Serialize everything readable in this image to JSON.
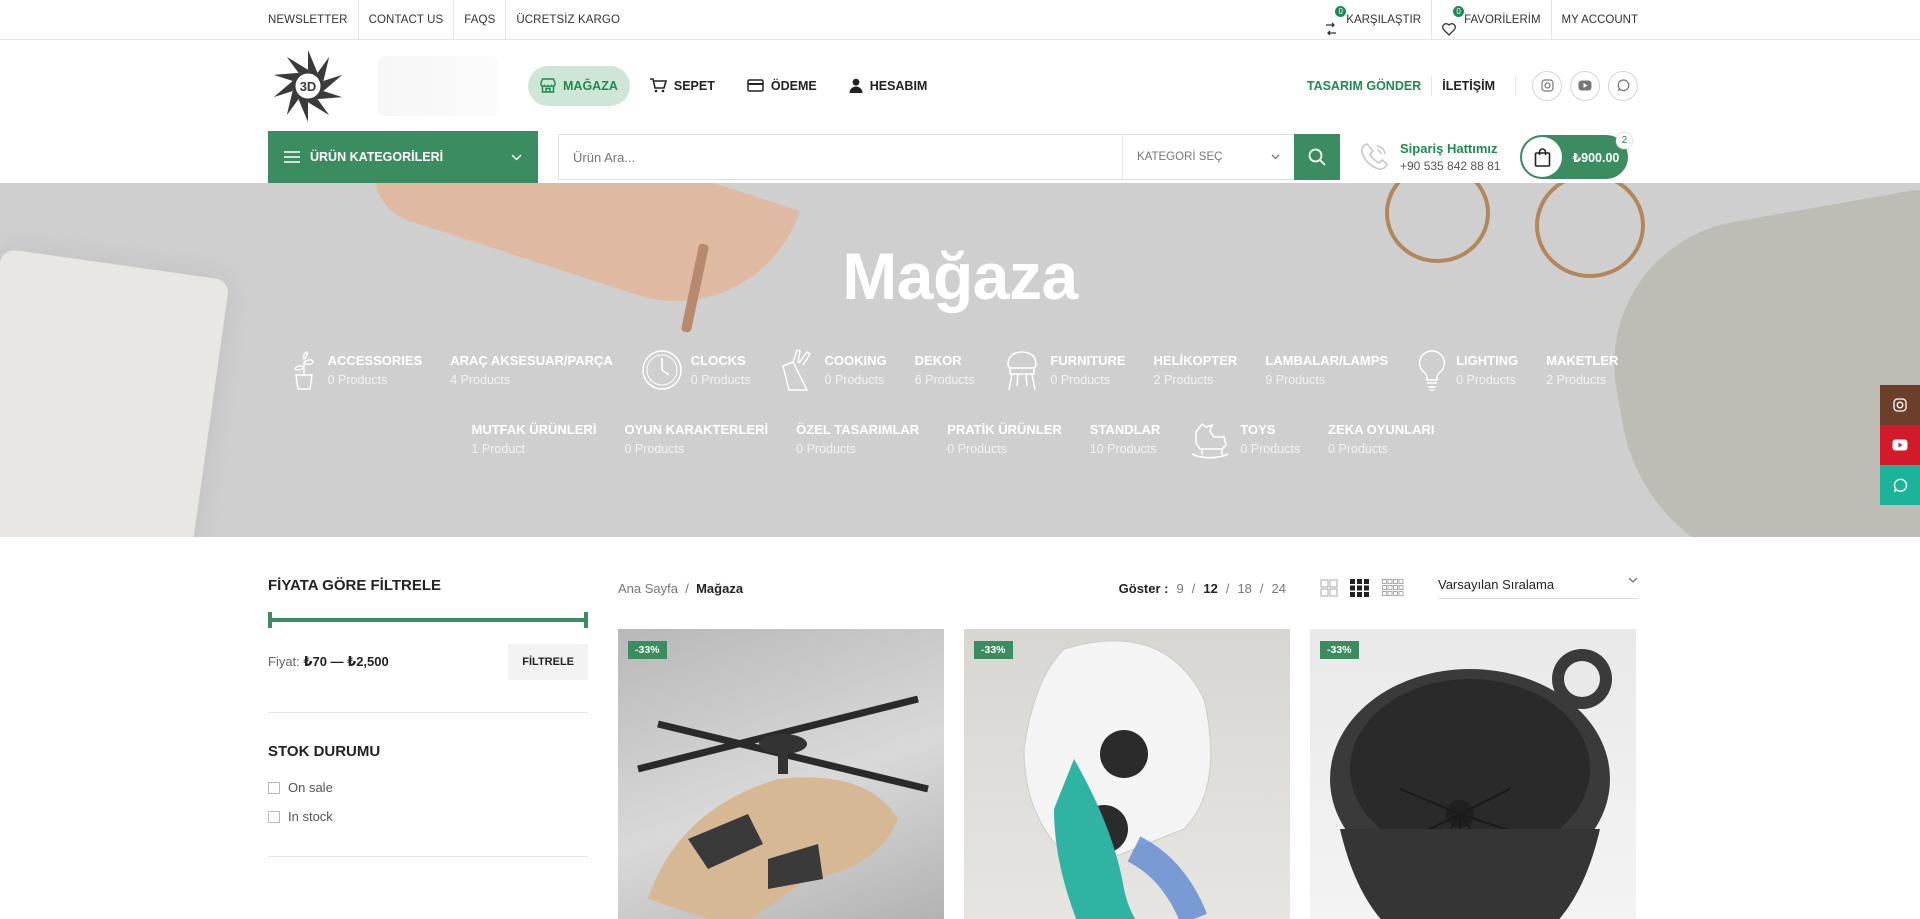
{
  "topbar": {
    "left_links": [
      "NEWSLETTER",
      "CONTACT US",
      "FAQS",
      "ÜCRETSİZ KARGO"
    ],
    "compare": {
      "label": "KARŞILAŞTIR",
      "count": "0"
    },
    "favorites": {
      "label": "FAVORİLERİM",
      "count": "0"
    },
    "account": "MY ACCOUNT"
  },
  "header": {
    "logo_text": "3D",
    "nav": [
      {
        "label": "MAĞAZA",
        "icon": "store-icon",
        "active": true
      },
      {
        "label": "SEPET",
        "icon": "cart-icon"
      },
      {
        "label": "ÖDEME",
        "icon": "credit-card-icon"
      },
      {
        "label": "HESABIM",
        "icon": "user-icon"
      }
    ],
    "design_link": "TASARIM GÖNDER",
    "contact_link": "İLETİŞİM",
    "socials": [
      "instagram-icon",
      "youtube-icon",
      "whatsapp-icon"
    ]
  },
  "searchbar": {
    "categories_label": "ÜRÜN KATEGORİLERİ",
    "search_placeholder": "Ürün Ara...",
    "category_select": "KATEGORİ SEÇ",
    "phone_title": "Sipariş Hattımız",
    "phone_number": "+90 535 842 88 81",
    "cart_amount": "₺900.00",
    "cart_count": "2"
  },
  "hero": {
    "title": "Mağaza",
    "row1": [
      {
        "name": "ACCESSORIES",
        "count": "0 Products",
        "icon": "plant-icon"
      },
      {
        "name": "ARAÇ AKSESUAR/PARÇA",
        "count": "4 Products"
      },
      {
        "name": "CLOCKS",
        "count": "0 Products",
        "icon": "clock-icon"
      },
      {
        "name": "COOKING",
        "count": "0 Products",
        "icon": "knife-block-icon"
      },
      {
        "name": "DEKOR",
        "count": "6 Products"
      },
      {
        "name": "FURNITURE",
        "count": "0 Products",
        "icon": "chair-icon"
      },
      {
        "name": "HELİKOPTER",
        "count": "2 Products"
      },
      {
        "name": "LAMBALAR/LAMPS",
        "count": "9 Products"
      },
      {
        "name": "LIGHTING",
        "count": "0 Products",
        "icon": "bulb-icon"
      },
      {
        "name": "MAKETLER",
        "count": "2 Products"
      }
    ],
    "row2": [
      {
        "name": "MUTFAK ÜRÜNLERİ",
        "count": "1 Product"
      },
      {
        "name": "OYUN KARAKTERLERİ",
        "count": "0 Products"
      },
      {
        "name": "ÖZEL TASARIMLAR",
        "count": "0 Products"
      },
      {
        "name": "PRATİK ÜRÜNLER",
        "count": "0 Products"
      },
      {
        "name": "STANDLAR",
        "count": "10 Products"
      },
      {
        "name": "TOYS",
        "count": "0 Products",
        "icon": "rocking-horse-icon"
      },
      {
        "name": "ZEKA OYUNLARI",
        "count": "0 Products"
      }
    ]
  },
  "sidebar": {
    "price_filter_title": "FİYATA GÖRE FİLTRELE",
    "price_label": "Fiyat:",
    "price_range": "₺70 — ₺2,500",
    "filter_button": "FİLTRELE",
    "stock_title": "STOK DURUMU",
    "stock_options": [
      "On sale",
      "In stock"
    ]
  },
  "toolbar": {
    "breadcrumb_home": "Ana Sayfa",
    "breadcrumb_current": "Mağaza",
    "show_label": "Göster :",
    "show_options": [
      "9",
      "12",
      "18",
      "24"
    ],
    "show_selected": "12",
    "sort_label": "Varsayılan Sıralama"
  },
  "products": [
    {
      "discount": "-33%"
    },
    {
      "discount": "-33%"
    },
    {
      "discount": "-33%"
    }
  ],
  "colors": {
    "accent": "#3b8c60",
    "accent_text": "#1f8a50",
    "hero_bg": "#cfcfcf",
    "instagram": "#6b3f2a",
    "youtube": "#d11b2a",
    "whatsapp": "#1cb39b"
  }
}
